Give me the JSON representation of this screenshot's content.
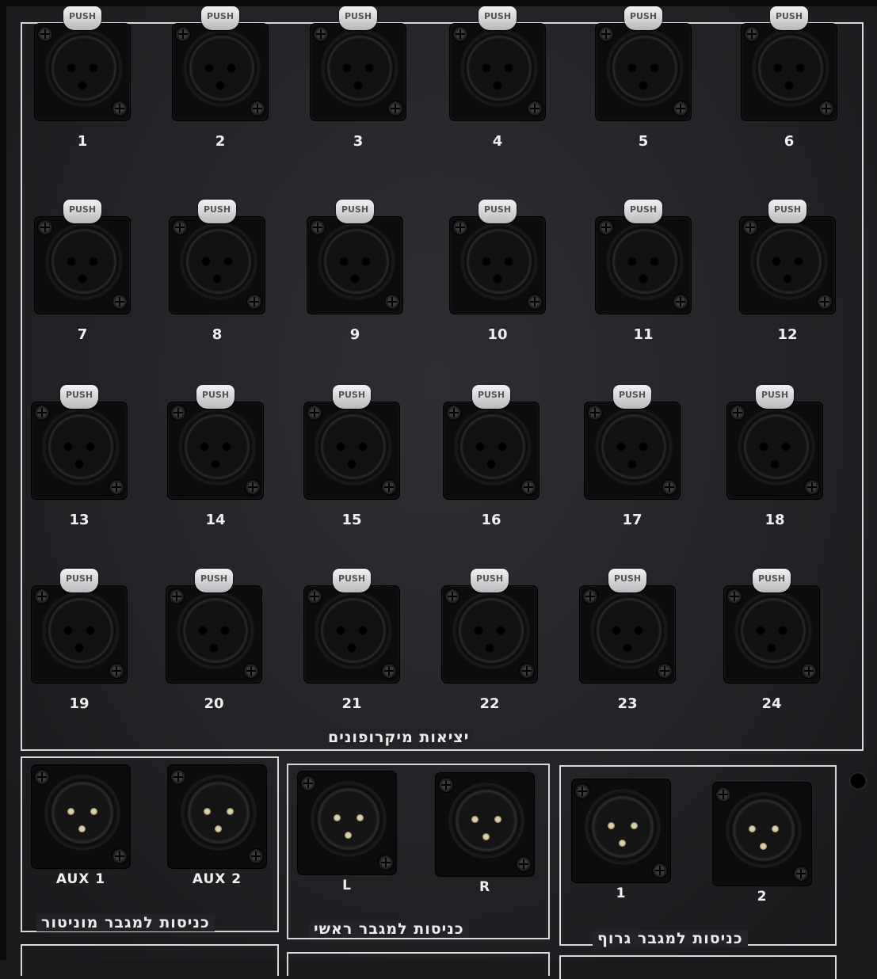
{
  "panel": {
    "section_mic": "יציאות מיקרופונים",
    "section_monitor": "כניסות למגבר מוניטור",
    "section_main": "כניסות למגבר ראשי",
    "section_group": "כניסות למגבר גרוף",
    "tab_text": "PUSH"
  },
  "mic_outputs": [
    {
      "n": "1"
    },
    {
      "n": "2"
    },
    {
      "n": "3"
    },
    {
      "n": "4"
    },
    {
      "n": "5"
    },
    {
      "n": "6"
    },
    {
      "n": "7"
    },
    {
      "n": "8"
    },
    {
      "n": "9"
    },
    {
      "n": "10"
    },
    {
      "n": "11"
    },
    {
      "n": "12"
    },
    {
      "n": "13"
    },
    {
      "n": "14"
    },
    {
      "n": "15"
    },
    {
      "n": "16"
    },
    {
      "n": "17"
    },
    {
      "n": "18"
    },
    {
      "n": "19"
    },
    {
      "n": "20"
    },
    {
      "n": "21"
    },
    {
      "n": "22"
    },
    {
      "n": "23"
    },
    {
      "n": "24"
    }
  ],
  "amp_inputs": {
    "monitor": [
      "AUX 1",
      "AUX 2"
    ],
    "main": [
      "L",
      "R"
    ],
    "group": [
      "1",
      "2"
    ]
  }
}
